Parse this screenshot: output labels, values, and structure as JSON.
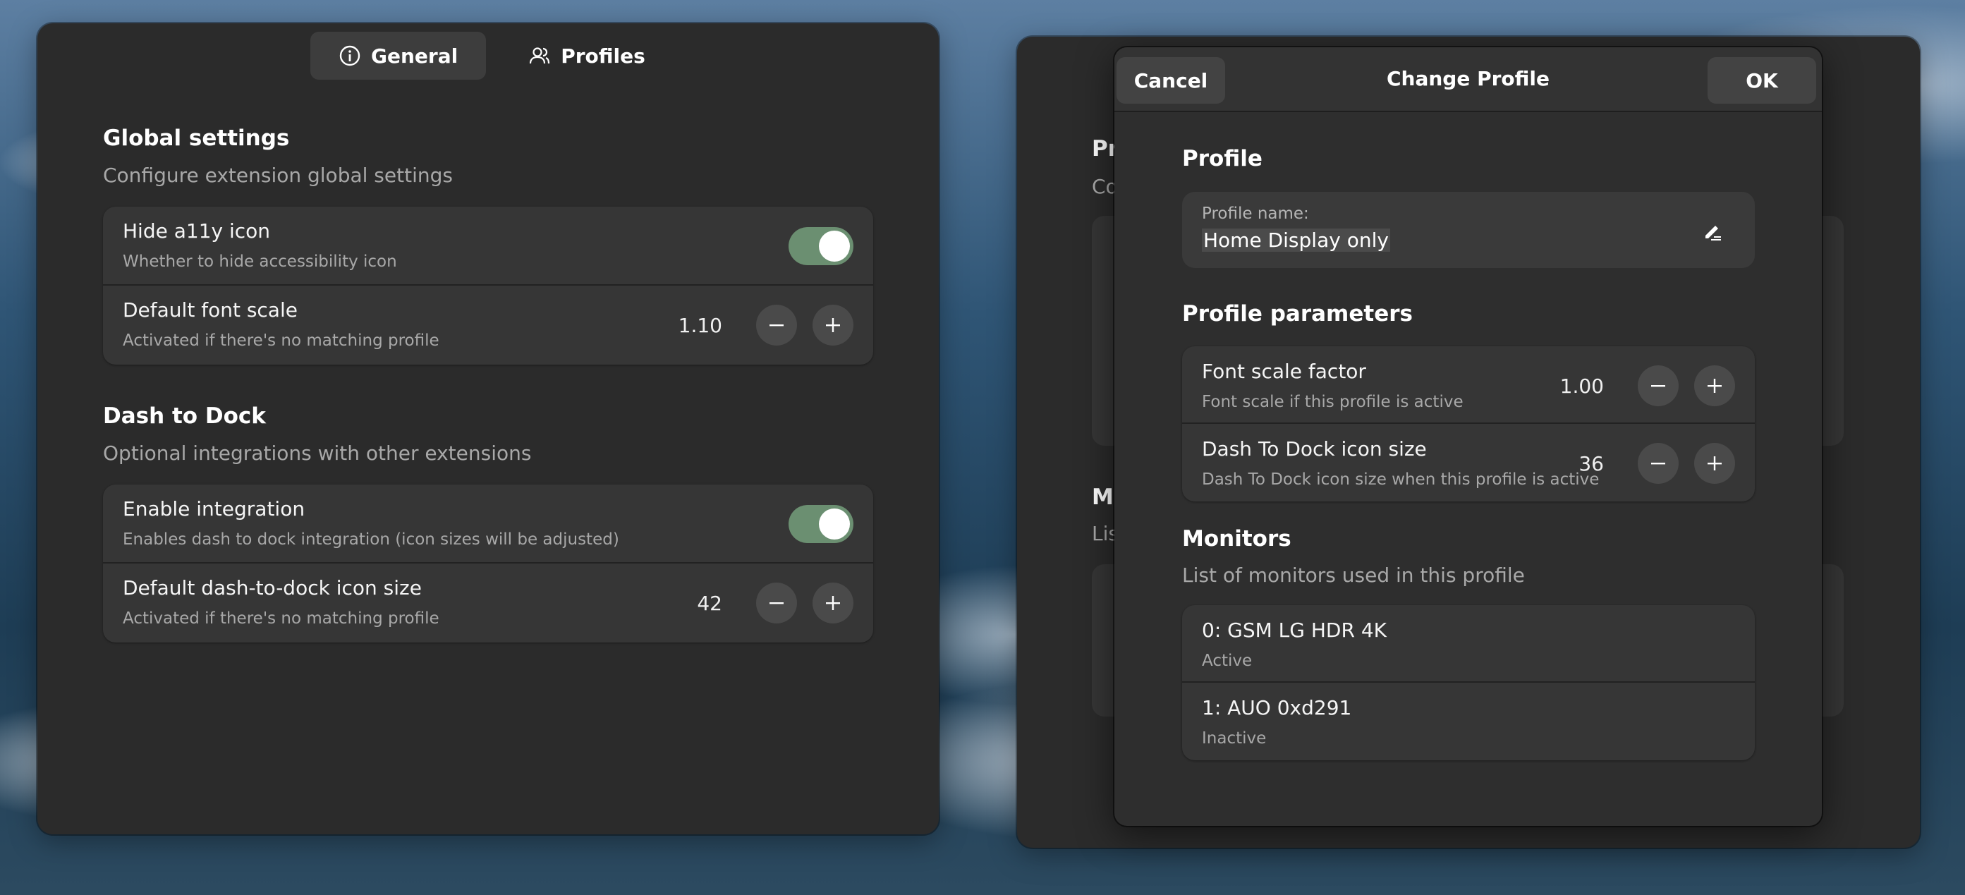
{
  "tabs": [
    {
      "label": "General",
      "icon": "info-icon",
      "active": true
    },
    {
      "label": "Profiles",
      "icon": "users-icon",
      "active": false
    }
  ],
  "global": {
    "title": "Global settings",
    "subtitle": "Configure extension global settings",
    "rows": [
      {
        "title": "Hide a11y icon",
        "subtitle": "Whether to hide accessibility icon",
        "control": "switch",
        "on": true
      },
      {
        "title": "Default font scale",
        "subtitle": "Activated if there's no matching profile",
        "control": "spin",
        "value": "1.10"
      }
    ]
  },
  "dock": {
    "title": "Dash to Dock",
    "subtitle": "Optional integrations with other extensions",
    "rows": [
      {
        "title": "Enable integration",
        "subtitle": "Enables dash to dock integration (icon sizes will be adjusted)",
        "control": "switch",
        "on": true
      },
      {
        "title": "Default dash-to-dock icon size",
        "subtitle": "Activated if there's no matching profile",
        "control": "spin",
        "value": "42"
      }
    ]
  },
  "background_dialog": {
    "visible_title_fragment": "Pr",
    "visible_sub_fragment": "Co",
    "visible_title2_fragment": "Mo",
    "visible_sub2_fragment": "Lis"
  },
  "modal": {
    "title": "Change Profile",
    "cancel_label": "Cancel",
    "ok_label": "OK",
    "profile_section": "Profile",
    "profile_name_label": "Profile name:",
    "profile_name_value": "Home Display only",
    "params_section": "Profile parameters",
    "params": [
      {
        "title": "Font scale factor",
        "subtitle": "Font scale if this profile is active",
        "value": "1.00"
      },
      {
        "title": "Dash To Dock icon size",
        "subtitle": "Dash To Dock icon size when this profile is active",
        "value": "36"
      }
    ],
    "monitors_section": "Monitors",
    "monitors_sub": "List of monitors used in this profile",
    "monitors": [
      {
        "title": "0: GSM LG HDR 4K",
        "status": "Active"
      },
      {
        "title": "1: AUO 0xd291",
        "status": "Inactive"
      }
    ]
  },
  "colors": {
    "switch_on": "#6b8f71",
    "window_bg": "#2b2b2b",
    "row_bg": "#363636"
  }
}
